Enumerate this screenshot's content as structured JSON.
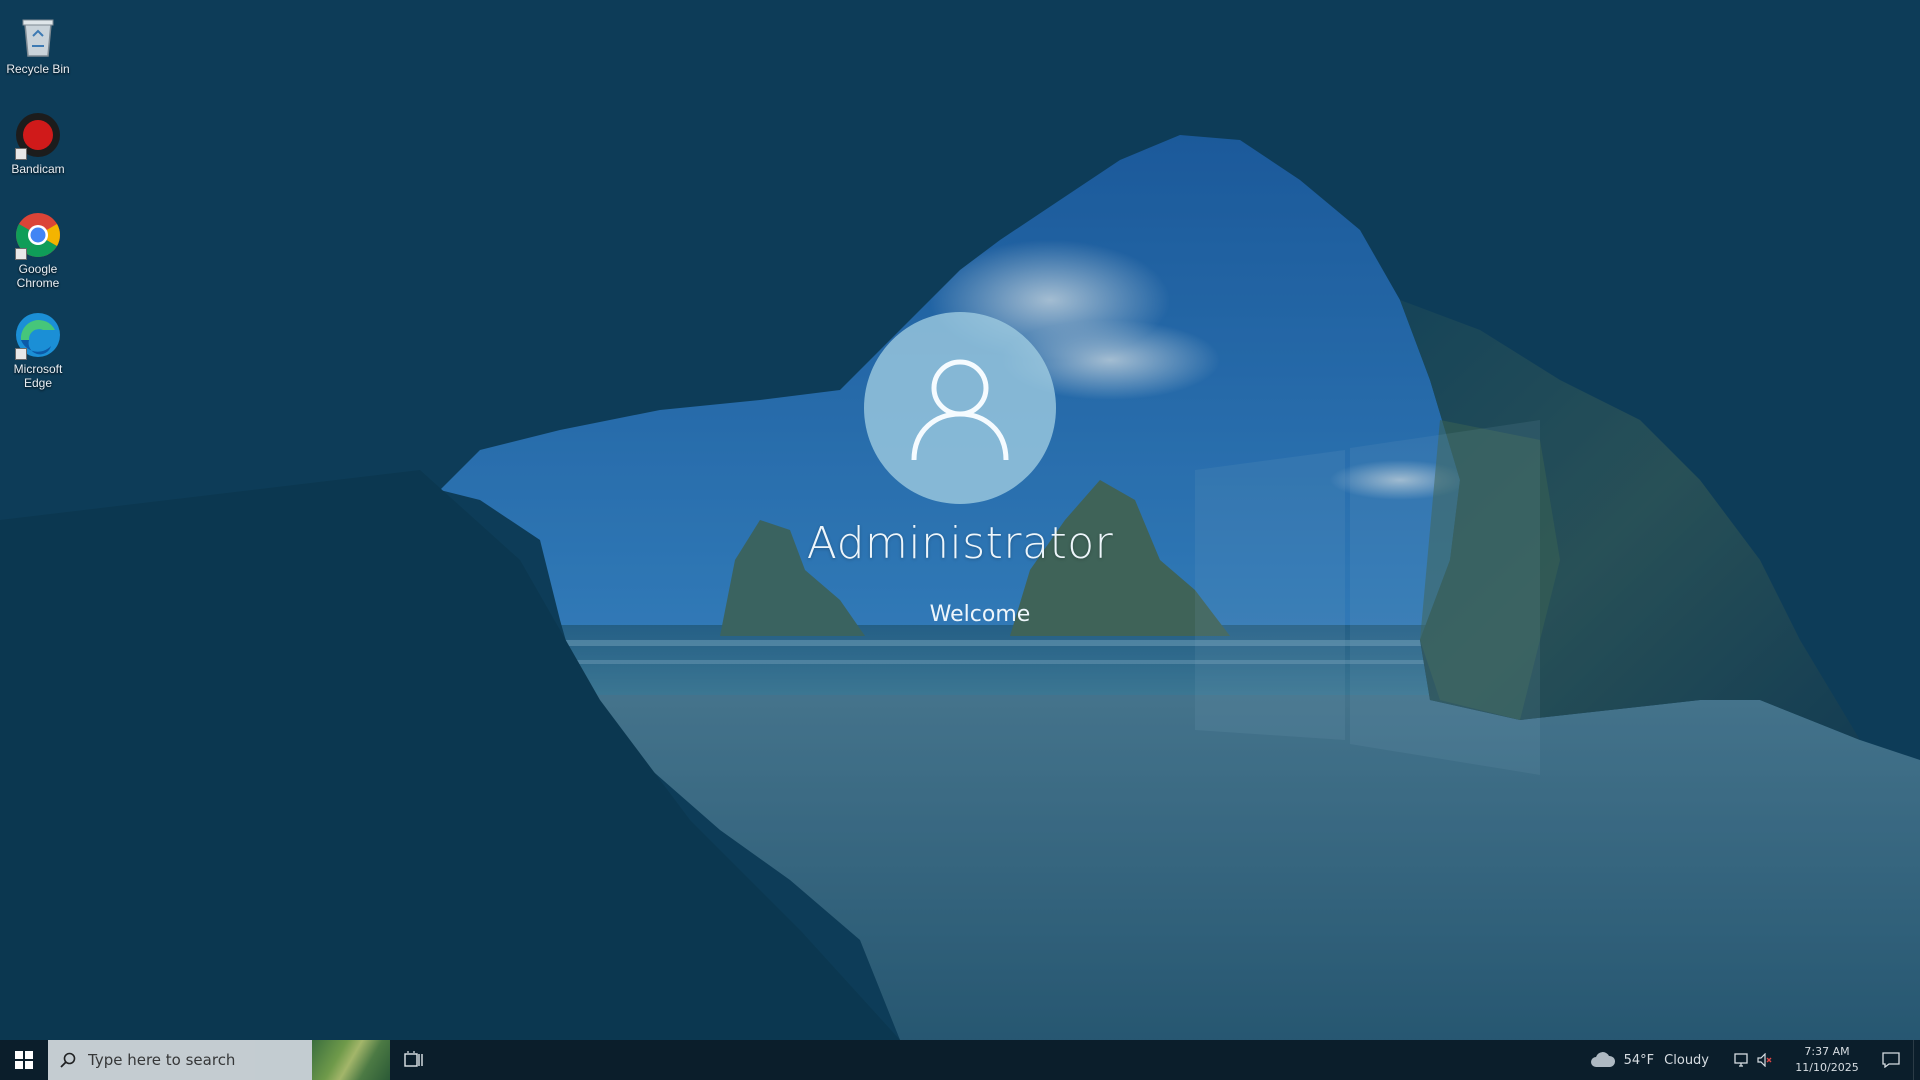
{
  "desktop": {
    "icons": [
      {
        "label": "Recycle Bin",
        "icon": "recycle-bin-icon"
      },
      {
        "label": "Bandicam",
        "icon": "bandicam-icon"
      },
      {
        "label": "Google Chrome",
        "icon": "chrome-icon"
      },
      {
        "label": "Microsoft Edge",
        "icon": "edge-icon"
      }
    ]
  },
  "welcome_screen": {
    "username": "Administrator",
    "status": "Welcome",
    "avatar_icon": "user-icon"
  },
  "taskbar": {
    "start_icon": "windows-logo-icon",
    "search_placeholder": "Type here to search",
    "search_icon": "search-icon",
    "taskview_icon": "task-view-icon",
    "weather": {
      "icon": "cloud-icon",
      "temperature": "54°F",
      "condition": "Cloudy"
    },
    "tray_icons": [
      "network-icon",
      "volume-muted-icon"
    ],
    "clock": {
      "time": "7:37 AM",
      "date": "11/10/2025"
    },
    "notification_icon": "action-center-icon"
  }
}
